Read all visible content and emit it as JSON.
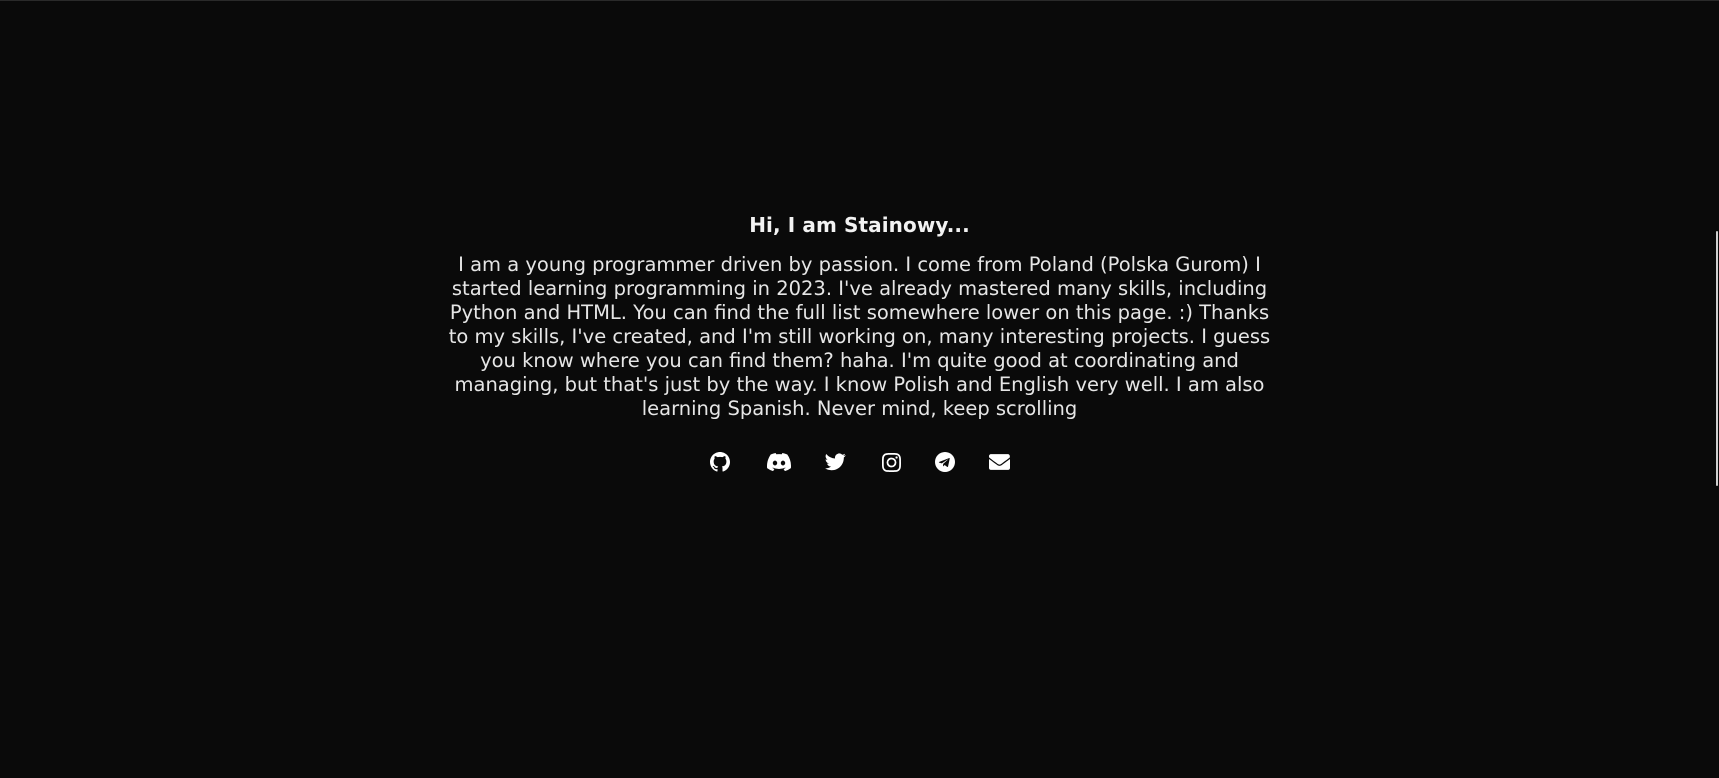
{
  "hero": {
    "title": "Hi, I am Stainowy...",
    "bio": "I am a young programmer driven by passion. I come from Poland (Polska Gurom) I started learning programming in 2023. I've already mastered many skills, including Python and HTML. You can find the full list somewhere lower on this page. :) Thanks to my skills, I've created, and I'm still working on, many interesting projects. I guess you know where you can find them? haha. I'm quite good at coordinating and managing, but that's just by the way. I know Polish and English very well. I am also learning Spanish. Never mind, keep scrolling"
  },
  "socials": [
    {
      "icon": "github-icon"
    },
    {
      "icon": "discord-icon"
    },
    {
      "icon": "twitter-icon"
    },
    {
      "icon": "instagram-icon"
    },
    {
      "icon": "telegram-icon"
    },
    {
      "icon": "envelope-icon"
    }
  ],
  "colors": {
    "background": "#0a0a0a",
    "text": "#f0f0f0",
    "icon": "#ffffff"
  }
}
